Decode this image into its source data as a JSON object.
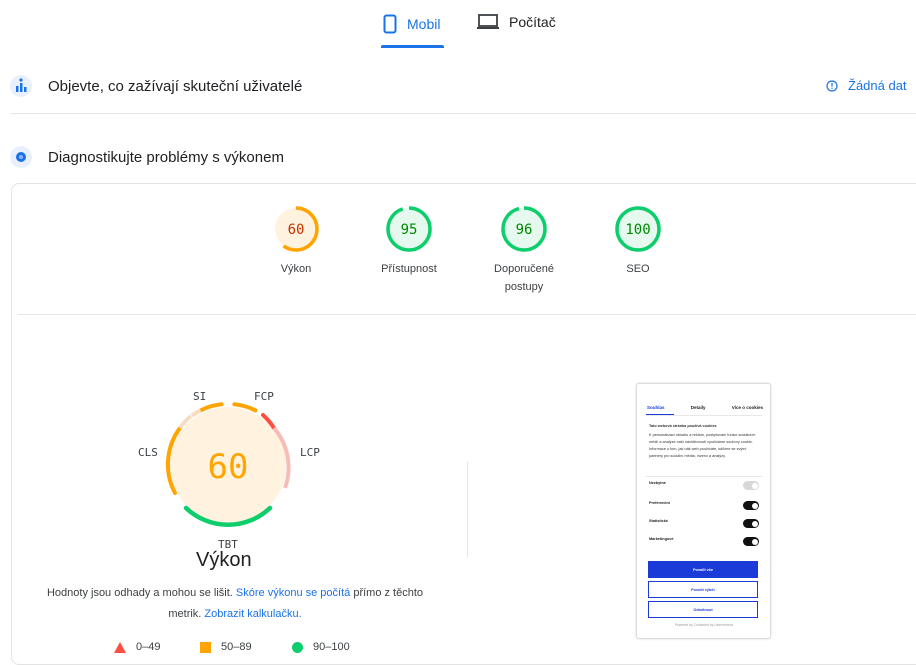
{
  "tabs": [
    {
      "label": "Mobil",
      "icon": "phone-icon",
      "active": true
    },
    {
      "label": "Počítač",
      "icon": "laptop-icon",
      "active": false
    }
  ],
  "field_data": {
    "title": "Objevte, co zažívají skuteční uživatelé",
    "status": "Žádná dat"
  },
  "lab_data": {
    "title": "Diagnostikujte problémy s výkonem"
  },
  "categories": [
    {
      "score": "60",
      "label": "Výkon",
      "value": 60,
      "color": "#ffa400"
    },
    {
      "score": "95",
      "label": "Přístupnost",
      "value": 95,
      "color": "#0cce6b"
    },
    {
      "score": "96",
      "label": "Doporučené postupy",
      "value": 96,
      "color": "#0cce6b"
    },
    {
      "score": "100",
      "label": "SEO",
      "value": 100,
      "color": "#0cce6b"
    }
  ],
  "performance": {
    "score": "60",
    "title": "Výkon",
    "metric_labels": {
      "si": "SI",
      "fcp": "FCP",
      "lcp": "LCP",
      "tbt": "TBT",
      "cls": "CLS"
    },
    "note": {
      "text_before": "Hodnoty jsou odhady a mohou se lišit.",
      "link1": "Skóre výkonu se počítá",
      "text_middle": "přímo z těchto metrik.",
      "link2": "Zobrazit kalkulačku."
    }
  },
  "legend": [
    {
      "range": "0–49",
      "color": "#ff4e42"
    },
    {
      "range": "50–89",
      "color": "#ffa400"
    },
    {
      "range": "90–100",
      "color": "#0cce6b"
    }
  ],
  "colors": {
    "accent": "#1a73e8",
    "poor": "#ff4e42",
    "average": "#ffa400",
    "good": "#0cce6b"
  },
  "screenshot": {
    "tabs": [
      "Souhlas",
      "Detaily",
      "Více o cookies"
    ],
    "heading": "Tato webová stránka používá cookies",
    "body": "K personalizaci obsahu a reklam, poskytování funkcí sociálních médií a analýze naší návštěvnosti využíváme soubory cookie. Informace o tom, jak náš web používáte, sdílíme se svými partnery pro sociální média, inzerci a analýzy.",
    "toggles": [
      {
        "label": "Nezbytné",
        "on": false
      },
      {
        "label": "Preferenční",
        "on": true
      },
      {
        "label": "Statistické",
        "on": true
      },
      {
        "label": "Marketingové",
        "on": true
      }
    ],
    "buttons": {
      "allow_all": "Povolit vše",
      "allow_selection": "Povolit výběr",
      "deny": "Odmítnout"
    },
    "footer": "Powered by Cookiebot by Usercentrics"
  }
}
